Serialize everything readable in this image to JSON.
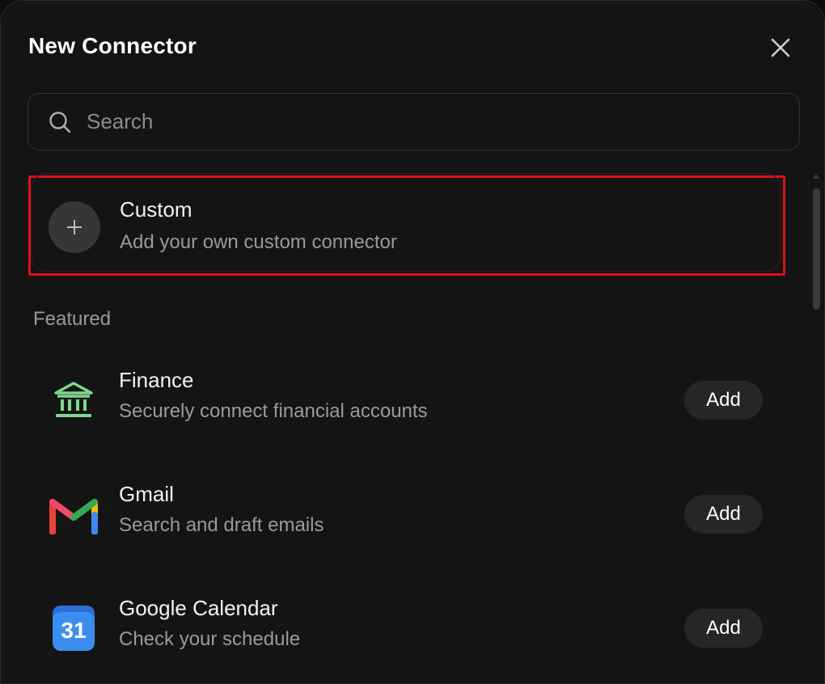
{
  "dialog": {
    "title": "New Connector"
  },
  "search": {
    "placeholder": "Search",
    "value": ""
  },
  "custom": {
    "title": "Custom",
    "subtitle": "Add your own custom connector"
  },
  "featured": {
    "label": "Featured",
    "items": [
      {
        "title": "Finance",
        "subtitle": "Securely connect financial accounts",
        "icon": "bank-icon",
        "action": "Add"
      },
      {
        "title": "Gmail",
        "subtitle": "Search and draft emails",
        "icon": "gmail-icon",
        "action": "Add"
      },
      {
        "title": "Google Calendar",
        "subtitle": "Check your schedule",
        "icon": "google-calendar-icon",
        "icon_text": "31",
        "action": "Add"
      }
    ]
  },
  "colors": {
    "background": "#141414",
    "highlight": "#e01010",
    "finance_icon": "#7ed58f",
    "calendar_icon": "#3b8ef0"
  }
}
